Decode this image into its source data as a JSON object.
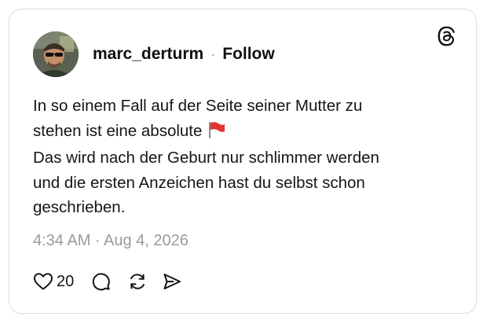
{
  "post": {
    "username": "marc_derturm",
    "separator": "·",
    "follow_label": "Follow",
    "text_line1": "In so einem Fall auf der Seite seiner Mutter zu",
    "text_line2": "stehen ist eine absolute",
    "text_line3": "Das wird nach der Geburt nur schlimmer werden",
    "text_line4": "und die ersten Anzeichen hast du selbst schon",
    "text_line5": "geschrieben.",
    "flag_emoji": "red-flag-icon",
    "timestamp": "4:34 AM · Aug 4, 2026",
    "like_count": "20"
  },
  "icons": {
    "logo": "threads-logo-icon",
    "like": "heart-icon",
    "comment": "comment-bubble-icon",
    "repost": "repost-icon",
    "share": "send-icon"
  },
  "colors": {
    "text": "#101010",
    "muted": "#9a9a9a",
    "border": "#dcdcdc",
    "flag": "#e3342f"
  }
}
